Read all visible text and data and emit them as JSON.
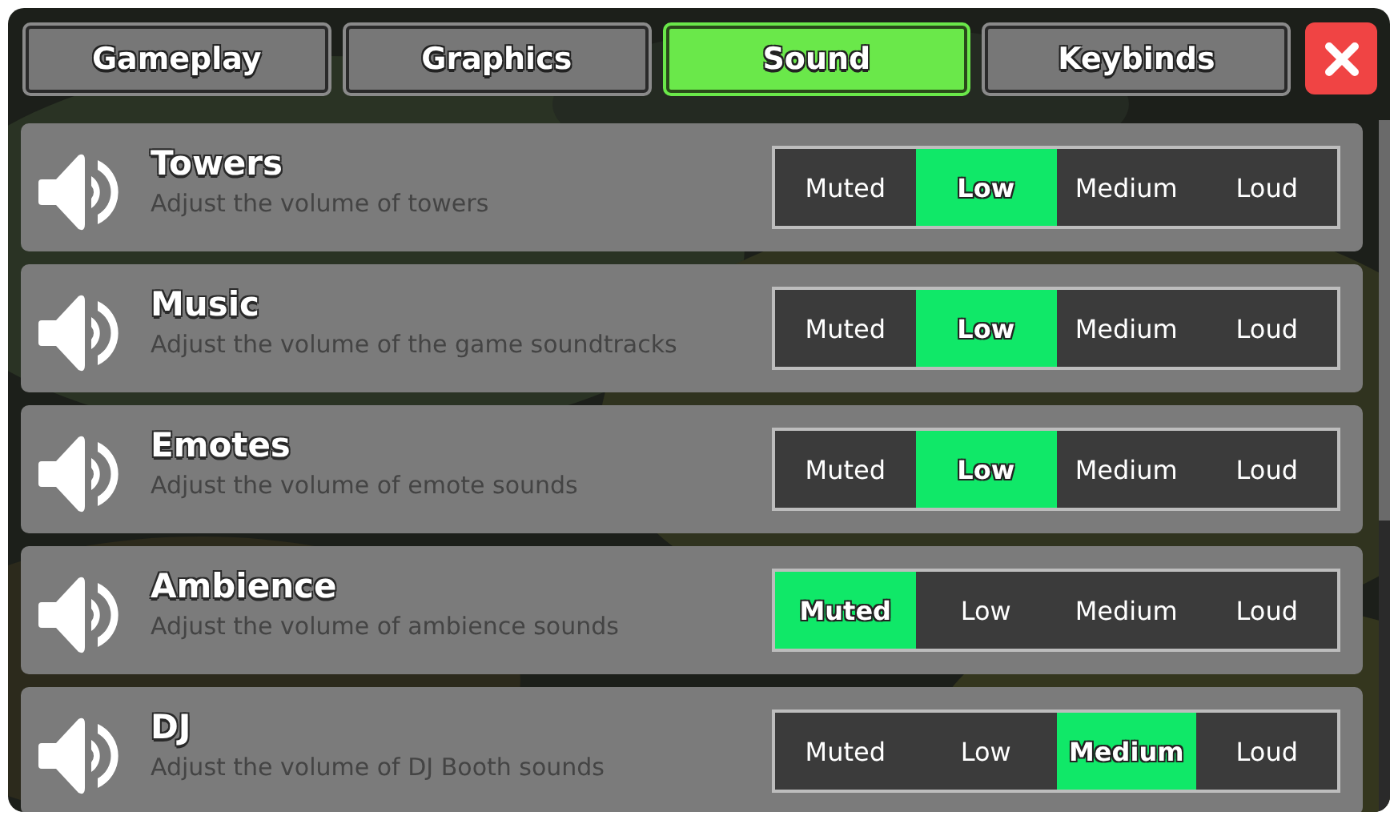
{
  "tabs": [
    {
      "label": "Gameplay",
      "selected": false
    },
    {
      "label": "Graphics",
      "selected": false
    },
    {
      "label": "Sound",
      "selected": true
    },
    {
      "label": "Keybinds",
      "selected": false
    }
  ],
  "settings": [
    {
      "title": "Towers",
      "description": "Adjust the volume of towers",
      "options": [
        {
          "label": "Muted",
          "selected": false
        },
        {
          "label": "Low",
          "selected": true
        },
        {
          "label": "Medium",
          "selected": false
        },
        {
          "label": "Loud",
          "selected": false
        }
      ]
    },
    {
      "title": "Music",
      "description": "Adjust the volume of the game soundtracks",
      "options": [
        {
          "label": "Muted",
          "selected": false
        },
        {
          "label": "Low",
          "selected": true
        },
        {
          "label": "Medium",
          "selected": false
        },
        {
          "label": "Loud",
          "selected": false
        }
      ]
    },
    {
      "title": "Emotes",
      "description": "Adjust the volume of emote sounds",
      "options": [
        {
          "label": "Muted",
          "selected": false
        },
        {
          "label": "Low",
          "selected": true
        },
        {
          "label": "Medium",
          "selected": false
        },
        {
          "label": "Loud",
          "selected": false
        }
      ]
    },
    {
      "title": "Ambience",
      "description": "Adjust the volume of ambience sounds",
      "options": [
        {
          "label": "Muted",
          "selected": true
        },
        {
          "label": "Low",
          "selected": false
        },
        {
          "label": "Medium",
          "selected": false
        },
        {
          "label": "Loud",
          "selected": false
        }
      ]
    },
    {
      "title": "DJ",
      "description": "Adjust the volume of DJ Booth sounds",
      "options": [
        {
          "label": "Muted",
          "selected": false
        },
        {
          "label": "Low",
          "selected": false
        },
        {
          "label": "Medium",
          "selected": true
        },
        {
          "label": "Loud",
          "selected": false
        }
      ]
    }
  ]
}
